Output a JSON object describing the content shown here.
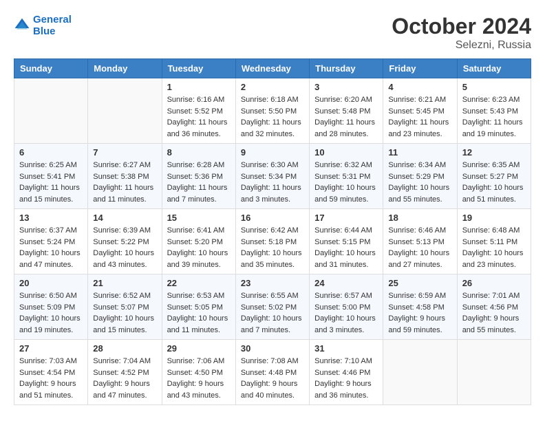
{
  "header": {
    "logo_line1": "General",
    "logo_line2": "Blue",
    "month": "October 2024",
    "location": "Selezni, Russia"
  },
  "weekdays": [
    "Sunday",
    "Monday",
    "Tuesday",
    "Wednesday",
    "Thursday",
    "Friday",
    "Saturday"
  ],
  "weeks": [
    [
      {
        "day": "",
        "info": ""
      },
      {
        "day": "",
        "info": ""
      },
      {
        "day": "1",
        "info": "Sunrise: 6:16 AM\nSunset: 5:52 PM\nDaylight: 11 hours and 36 minutes."
      },
      {
        "day": "2",
        "info": "Sunrise: 6:18 AM\nSunset: 5:50 PM\nDaylight: 11 hours and 32 minutes."
      },
      {
        "day": "3",
        "info": "Sunrise: 6:20 AM\nSunset: 5:48 PM\nDaylight: 11 hours and 28 minutes."
      },
      {
        "day": "4",
        "info": "Sunrise: 6:21 AM\nSunset: 5:45 PM\nDaylight: 11 hours and 23 minutes."
      },
      {
        "day": "5",
        "info": "Sunrise: 6:23 AM\nSunset: 5:43 PM\nDaylight: 11 hours and 19 minutes."
      }
    ],
    [
      {
        "day": "6",
        "info": "Sunrise: 6:25 AM\nSunset: 5:41 PM\nDaylight: 11 hours and 15 minutes."
      },
      {
        "day": "7",
        "info": "Sunrise: 6:27 AM\nSunset: 5:38 PM\nDaylight: 11 hours and 11 minutes."
      },
      {
        "day": "8",
        "info": "Sunrise: 6:28 AM\nSunset: 5:36 PM\nDaylight: 11 hours and 7 minutes."
      },
      {
        "day": "9",
        "info": "Sunrise: 6:30 AM\nSunset: 5:34 PM\nDaylight: 11 hours and 3 minutes."
      },
      {
        "day": "10",
        "info": "Sunrise: 6:32 AM\nSunset: 5:31 PM\nDaylight: 10 hours and 59 minutes."
      },
      {
        "day": "11",
        "info": "Sunrise: 6:34 AM\nSunset: 5:29 PM\nDaylight: 10 hours and 55 minutes."
      },
      {
        "day": "12",
        "info": "Sunrise: 6:35 AM\nSunset: 5:27 PM\nDaylight: 10 hours and 51 minutes."
      }
    ],
    [
      {
        "day": "13",
        "info": "Sunrise: 6:37 AM\nSunset: 5:24 PM\nDaylight: 10 hours and 47 minutes."
      },
      {
        "day": "14",
        "info": "Sunrise: 6:39 AM\nSunset: 5:22 PM\nDaylight: 10 hours and 43 minutes."
      },
      {
        "day": "15",
        "info": "Sunrise: 6:41 AM\nSunset: 5:20 PM\nDaylight: 10 hours and 39 minutes."
      },
      {
        "day": "16",
        "info": "Sunrise: 6:42 AM\nSunset: 5:18 PM\nDaylight: 10 hours and 35 minutes."
      },
      {
        "day": "17",
        "info": "Sunrise: 6:44 AM\nSunset: 5:15 PM\nDaylight: 10 hours and 31 minutes."
      },
      {
        "day": "18",
        "info": "Sunrise: 6:46 AM\nSunset: 5:13 PM\nDaylight: 10 hours and 27 minutes."
      },
      {
        "day": "19",
        "info": "Sunrise: 6:48 AM\nSunset: 5:11 PM\nDaylight: 10 hours and 23 minutes."
      }
    ],
    [
      {
        "day": "20",
        "info": "Sunrise: 6:50 AM\nSunset: 5:09 PM\nDaylight: 10 hours and 19 minutes."
      },
      {
        "day": "21",
        "info": "Sunrise: 6:52 AM\nSunset: 5:07 PM\nDaylight: 10 hours and 15 minutes."
      },
      {
        "day": "22",
        "info": "Sunrise: 6:53 AM\nSunset: 5:05 PM\nDaylight: 10 hours and 11 minutes."
      },
      {
        "day": "23",
        "info": "Sunrise: 6:55 AM\nSunset: 5:02 PM\nDaylight: 10 hours and 7 minutes."
      },
      {
        "day": "24",
        "info": "Sunrise: 6:57 AM\nSunset: 5:00 PM\nDaylight: 10 hours and 3 minutes."
      },
      {
        "day": "25",
        "info": "Sunrise: 6:59 AM\nSunset: 4:58 PM\nDaylight: 9 hours and 59 minutes."
      },
      {
        "day": "26",
        "info": "Sunrise: 7:01 AM\nSunset: 4:56 PM\nDaylight: 9 hours and 55 minutes."
      }
    ],
    [
      {
        "day": "27",
        "info": "Sunrise: 7:03 AM\nSunset: 4:54 PM\nDaylight: 9 hours and 51 minutes."
      },
      {
        "day": "28",
        "info": "Sunrise: 7:04 AM\nSunset: 4:52 PM\nDaylight: 9 hours and 47 minutes."
      },
      {
        "day": "29",
        "info": "Sunrise: 7:06 AM\nSunset: 4:50 PM\nDaylight: 9 hours and 43 minutes."
      },
      {
        "day": "30",
        "info": "Sunrise: 7:08 AM\nSunset: 4:48 PM\nDaylight: 9 hours and 40 minutes."
      },
      {
        "day": "31",
        "info": "Sunrise: 7:10 AM\nSunset: 4:46 PM\nDaylight: 9 hours and 36 minutes."
      },
      {
        "day": "",
        "info": ""
      },
      {
        "day": "",
        "info": ""
      }
    ]
  ]
}
